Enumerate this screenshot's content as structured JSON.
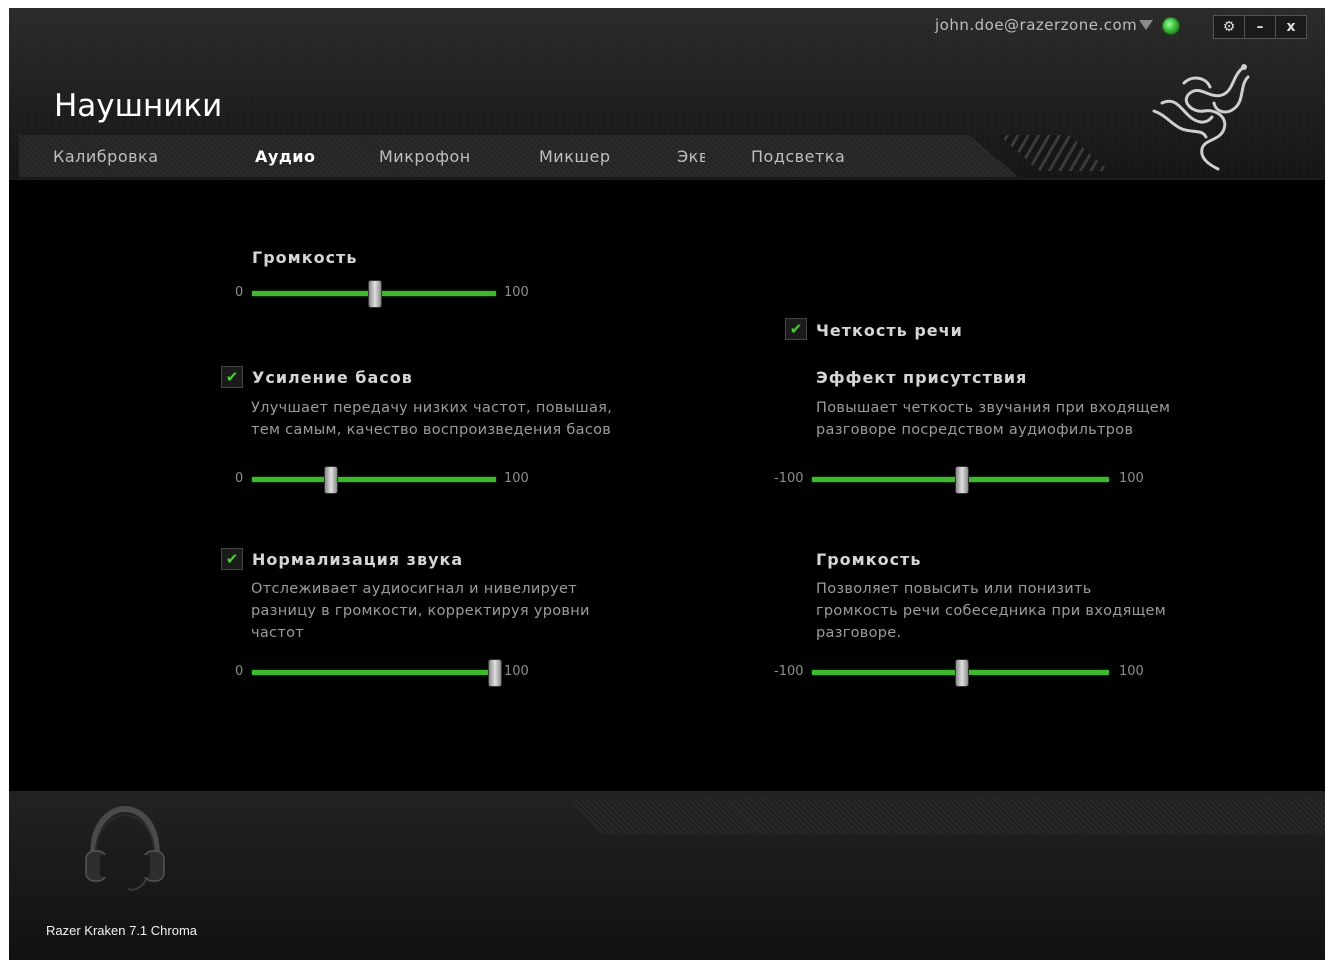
{
  "app": {
    "account_email": "john.doe@razerzone.com",
    "window_buttons": [
      "⚙",
      "–",
      "x"
    ],
    "page_title": "Наушники",
    "accent_color": "#44d62c"
  },
  "tabs": [
    {
      "label": "Калибровка",
      "active": false
    },
    {
      "label": "Аудио",
      "active": true
    },
    {
      "label": "Микрофон",
      "active": false
    },
    {
      "label": "Микшер",
      "active": false
    },
    {
      "label": "Экв",
      "active": false
    },
    {
      "label": "Подсветка",
      "active": false
    }
  ],
  "left": {
    "volume": {
      "title": "Громкость",
      "min": "0",
      "max": "100",
      "value": 50
    },
    "bass_boost": {
      "title": "Усиление басов",
      "checked": true,
      "check_icon": "✔",
      "desc1": "Улучшает передачу низких частот, повышая,",
      "desc2": "тем самым, качество воспроизведения басов",
      "min": "0",
      "max": "100",
      "value": 32
    },
    "normalization": {
      "title": "Нормализация звука",
      "checked": true,
      "check_icon": "✔",
      "desc1": "Отслеживает аудиосигнал и нивелирует",
      "desc2": "разницу в громкости, корректируя уровни",
      "desc3": "частот",
      "min": "0",
      "max": "100",
      "value": 99
    }
  },
  "right": {
    "voice_clarity": {
      "title": "Четкость речи",
      "checked": true,
      "check_icon": "✔"
    },
    "presence": {
      "title": "Эффект присутствия",
      "desc1": "Повышает четкость звучания при входящем",
      "desc2": "разговоре посредством аудиофильтров",
      "min": "-100",
      "max": "100",
      "value": 0
    },
    "voice_volume": {
      "title": "Громкость",
      "desc1": "Позволяет повысить или понизить",
      "desc2": "громкость речи собеседника при входящем",
      "desc3": "разговоре.",
      "min": "-100",
      "max": "100",
      "value": 0
    }
  },
  "device": {
    "name": "Razer Kraken 7.1 Chroma",
    "icon": "headset-icon"
  }
}
